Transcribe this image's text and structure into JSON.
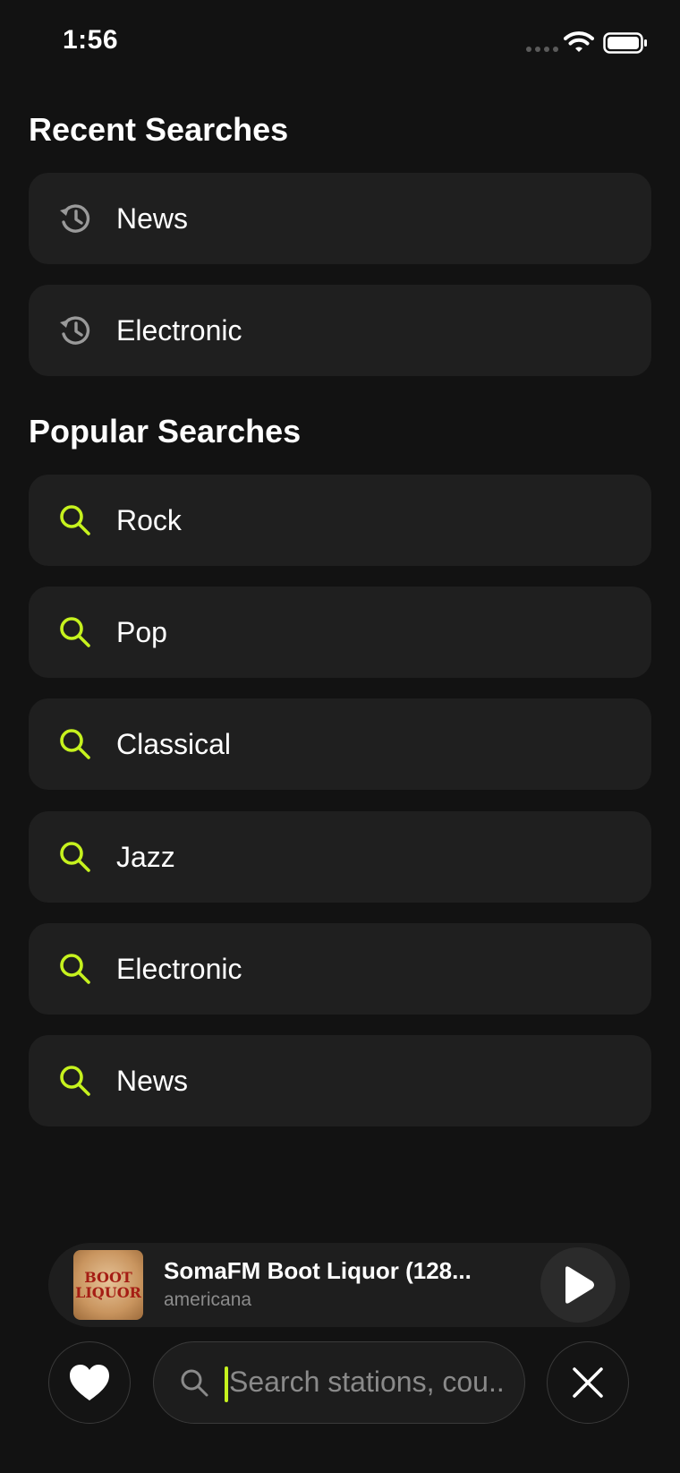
{
  "status_bar": {
    "time": "1:56"
  },
  "recent": {
    "title": "Recent Searches",
    "items": [
      {
        "label": "News",
        "icon": "history-icon"
      },
      {
        "label": "Electronic",
        "icon": "history-icon"
      }
    ]
  },
  "popular": {
    "title": "Popular Searches",
    "items": [
      {
        "label": "Rock",
        "icon": "search-icon"
      },
      {
        "label": "Pop",
        "icon": "search-icon"
      },
      {
        "label": "Classical",
        "icon": "search-icon"
      },
      {
        "label": "Jazz",
        "icon": "search-icon"
      },
      {
        "label": "Electronic",
        "icon": "search-icon"
      },
      {
        "label": "News",
        "icon": "search-icon"
      }
    ]
  },
  "now_playing": {
    "title": "SomaFM Boot Liquor (128...",
    "subtitle": "americana",
    "artwork_text": [
      "BOOT",
      "LIQUOR"
    ]
  },
  "search": {
    "placeholder": "Search stations, cou..."
  },
  "colors": {
    "accent": "#c6f21e",
    "background": "#121212",
    "row": "#1f1f1f",
    "muted": "#8b8b8b"
  }
}
